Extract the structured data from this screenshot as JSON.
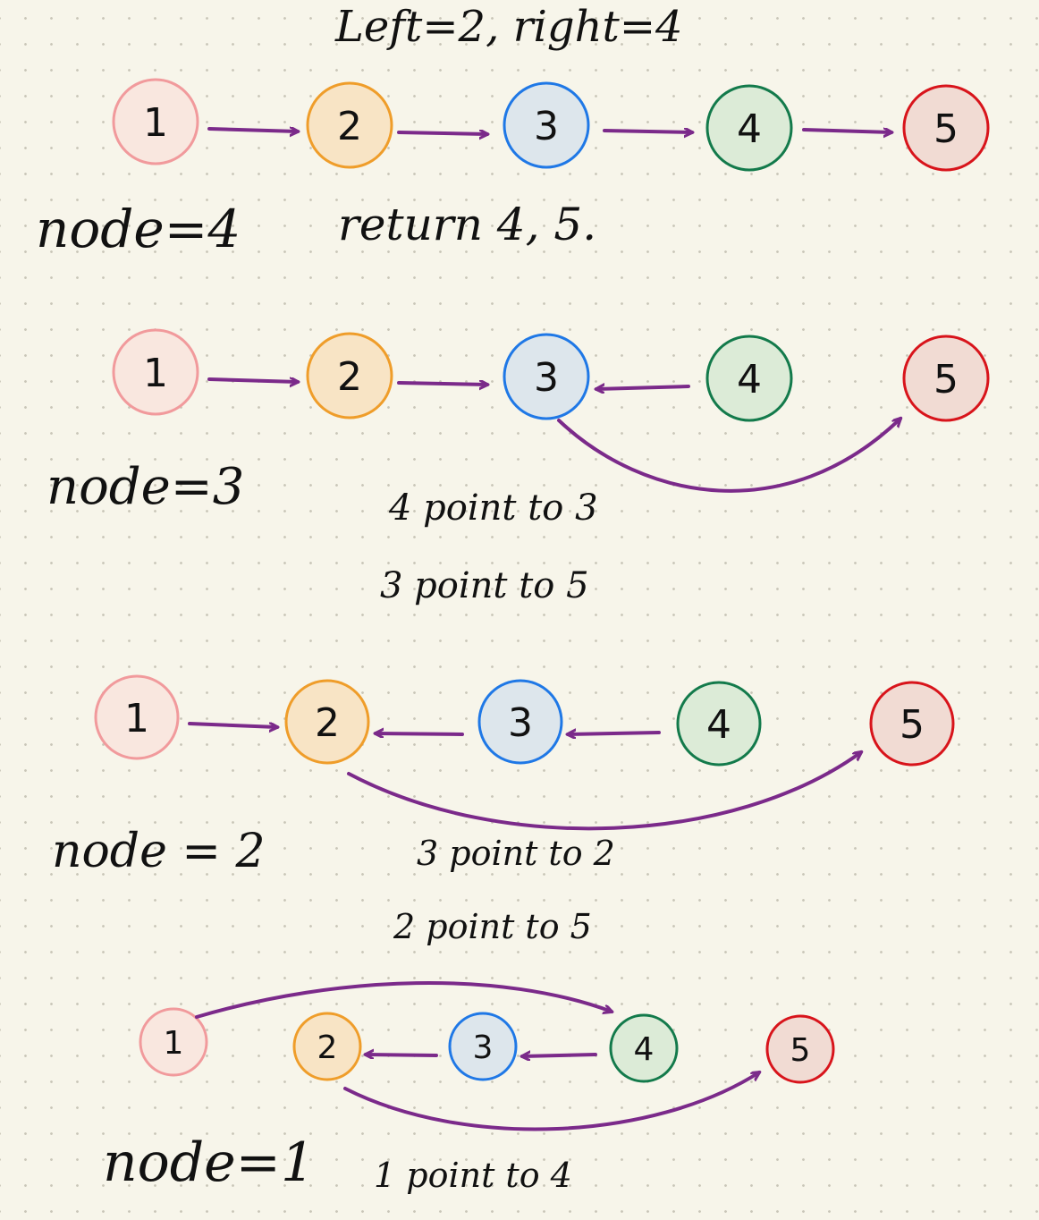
{
  "colors": {
    "arrow": "#7b2a8a",
    "node_colors": {
      "1": {
        "stroke": "#f19a9c",
        "fill": "#f9e7df"
      },
      "2": {
        "stroke": "#ef9d2a",
        "fill": "#f8e4c5"
      },
      "3": {
        "stroke": "#1f78e6",
        "fill": "#dde6ec"
      },
      "4": {
        "stroke": "#137a4b",
        "fill": "#dcebd7"
      },
      "5": {
        "stroke": "#d8141b",
        "fill": "#f1dbd3"
      }
    }
  },
  "header": {
    "text": "Left=2, right=4"
  },
  "steps": [
    {
      "nodes": [
        "1",
        "2",
        "3",
        "4",
        "5"
      ],
      "state_label": "node=4",
      "notes": [
        "return 4, 5."
      ]
    },
    {
      "nodes": [
        "1",
        "2",
        "3",
        "4",
        "5"
      ],
      "state_label": "node=3",
      "notes": [
        "4 point to 3",
        "3 point to 5"
      ]
    },
    {
      "nodes": [
        "1",
        "2",
        "3",
        "4",
        "5"
      ],
      "state_label": "node = 2",
      "notes": [
        "3 point to 2",
        "2 point to 5"
      ]
    },
    {
      "nodes": [
        "1",
        "2",
        "3",
        "4",
        "5"
      ],
      "state_label": "node=1",
      "notes": [
        "1 point to 4"
      ]
    }
  ]
}
